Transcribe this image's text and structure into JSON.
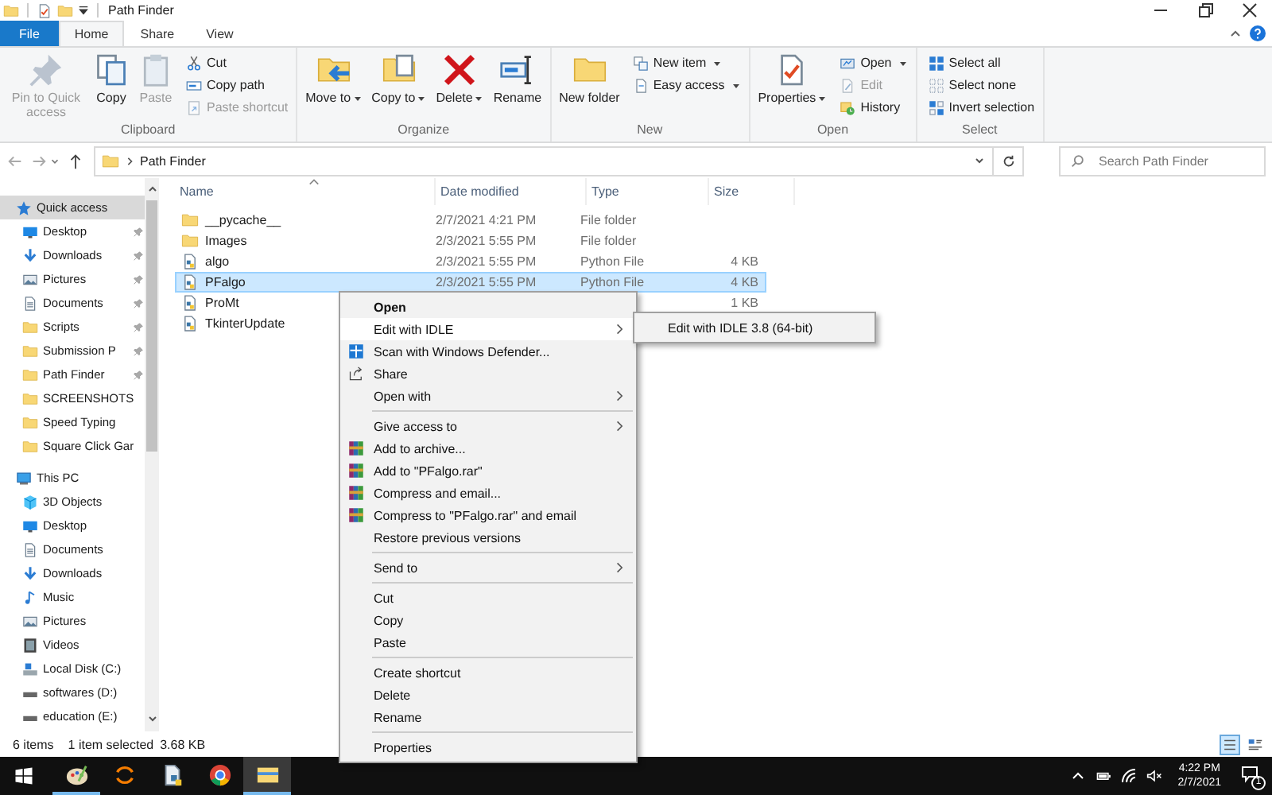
{
  "window": {
    "title": "Path Finder"
  },
  "ribbon_tabs": [
    {
      "label": "File",
      "kind": "file",
      "selected": false
    },
    {
      "label": "Home",
      "kind": "tab",
      "selected": true
    },
    {
      "label": "Share",
      "kind": "tab",
      "selected": false
    },
    {
      "label": "View",
      "kind": "tab",
      "selected": false
    }
  ],
  "ribbon_groups": [
    {
      "label": "Clipboard",
      "large": [
        {
          "label": "Pin to Quick access",
          "kind": "pin",
          "disabled": true,
          "has_menu": false
        },
        {
          "label": "Copy",
          "kind": "copy",
          "disabled": false,
          "has_menu": false
        },
        {
          "label": "Paste",
          "kind": "paste",
          "disabled": true,
          "has_menu": false
        }
      ],
      "small": [
        {
          "label": "Cut",
          "kind": "cut",
          "disabled": false,
          "has_menu": false
        },
        {
          "label": "Copy path",
          "kind": "copypath",
          "disabled": false,
          "has_menu": false
        },
        {
          "label": "Paste shortcut",
          "kind": "pasteshortcut",
          "disabled": true,
          "has_menu": false
        }
      ]
    },
    {
      "label": "Organize",
      "large": [
        {
          "label": "Move to",
          "kind": "move",
          "disabled": false,
          "has_menu": true
        },
        {
          "label": "Copy to",
          "kind": "copyto",
          "disabled": false,
          "has_menu": true
        },
        {
          "label": "Delete",
          "kind": "delete",
          "disabled": false,
          "has_menu": true
        },
        {
          "label": "Rename",
          "kind": "rename",
          "disabled": false,
          "has_menu": false
        }
      ]
    },
    {
      "label": "New",
      "large": [
        {
          "label": "New folder",
          "kind": "newfolder",
          "disabled": false,
          "has_menu": false
        }
      ],
      "small": [
        {
          "label": "New item",
          "kind": "newitem",
          "disabled": false,
          "has_menu": true
        },
        {
          "label": "Easy access",
          "kind": "easyaccess",
          "disabled": false,
          "has_menu": true
        }
      ]
    },
    {
      "label": "Open",
      "large": [
        {
          "label": "Properties",
          "kind": "properties",
          "disabled": false,
          "has_menu": true
        }
      ],
      "small": [
        {
          "label": "Open",
          "kind": "open",
          "disabled": false,
          "has_menu": true
        },
        {
          "label": "Edit",
          "kind": "edit",
          "disabled": true,
          "has_menu": false
        },
        {
          "label": "History",
          "kind": "history",
          "disabled": false,
          "has_menu": false
        }
      ]
    },
    {
      "label": "Select",
      "small": [
        {
          "label": "Select all",
          "kind": "selectall",
          "disabled": false,
          "has_menu": false
        },
        {
          "label": "Select none",
          "kind": "selectnone",
          "disabled": false,
          "has_menu": false
        },
        {
          "label": "Invert selection",
          "kind": "invert",
          "disabled": false,
          "has_menu": false
        }
      ]
    }
  ],
  "address": {
    "path": [
      "Path Finder"
    ]
  },
  "search": {
    "placeholder": "Search Path Finder"
  },
  "sidebar": [
    {
      "label": "Quick access",
      "kind": "star",
      "selected": true,
      "pinned": false,
      "children": [
        {
          "label": "Desktop",
          "kind": "desktop",
          "selected": false,
          "pinned": true
        },
        {
          "label": "Downloads",
          "kind": "downloads",
          "selected": false,
          "pinned": true
        },
        {
          "label": "Pictures",
          "kind": "pictures",
          "selected": false,
          "pinned": true
        },
        {
          "label": "Documents",
          "kind": "documents",
          "selected": false,
          "pinned": true
        },
        {
          "label": "Scripts",
          "kind": "folder",
          "selected": false,
          "pinned": true
        },
        {
          "label": "Submission P",
          "kind": "folder",
          "selected": false,
          "pinned": true
        },
        {
          "label": "Path Finder",
          "kind": "folder",
          "selected": false,
          "pinned": true
        },
        {
          "label": "SCREENSHOTS",
          "kind": "folder",
          "selected": false,
          "pinned": false
        },
        {
          "label": "Speed Typing",
          "kind": "folder",
          "selected": false,
          "pinned": false
        },
        {
          "label": "Square Click Gar",
          "kind": "folder",
          "selected": false,
          "pinned": false
        }
      ]
    },
    {
      "label": "This PC",
      "kind": "pc",
      "selected": false,
      "pinned": false,
      "children": [
        {
          "label": "3D Objects",
          "kind": "cube",
          "selected": false,
          "pinned": false
        },
        {
          "label": "Desktop",
          "kind": "desktop",
          "selected": false,
          "pinned": false
        },
        {
          "label": "Documents",
          "kind": "documents",
          "selected": false,
          "pinned": false
        },
        {
          "label": "Downloads",
          "kind": "downloads",
          "selected": false,
          "pinned": false
        },
        {
          "label": "Music",
          "kind": "music",
          "selected": false,
          "pinned": false
        },
        {
          "label": "Pictures",
          "kind": "pictures",
          "selected": false,
          "pinned": false
        },
        {
          "label": "Videos",
          "kind": "videos",
          "selected": false,
          "pinned": false
        },
        {
          "label": "Local Disk (C:)",
          "kind": "systemdisk",
          "selected": false,
          "pinned": false
        },
        {
          "label": "softwares (D:)",
          "kind": "drive",
          "selected": false,
          "pinned": false
        },
        {
          "label": "education (E:)",
          "kind": "drive",
          "selected": false,
          "pinned": false
        }
      ]
    }
  ],
  "table": {
    "columns": [
      {
        "label": "Name",
        "sorted": true
      },
      {
        "label": "Date modified",
        "sorted": false
      },
      {
        "label": "Type",
        "sorted": false
      },
      {
        "label": "Size",
        "sorted": false
      }
    ],
    "rows": [
      {
        "name": "__pycache__",
        "kind": "folder",
        "date": "2/7/2021 4:21 PM",
        "type": "File folder",
        "selected": false
      },
      {
        "name": "Images",
        "kind": "folder",
        "date": "2/3/2021 5:55 PM",
        "type": "File folder",
        "selected": false
      },
      {
        "name": "algo",
        "kind": "python",
        "date": "2/3/2021 5:55 PM",
        "type": "Python File",
        "size": "4 KB",
        "selected": false
      },
      {
        "name": "PFalgo",
        "kind": "python",
        "date": "2/3/2021 5:55 PM",
        "type": "Python File",
        "size": "4 KB",
        "selected": true
      },
      {
        "name": "ProMt",
        "kind": "python",
        "size": "1 KB",
        "selected": false
      },
      {
        "name": "TkinterUpdate",
        "kind": "python",
        "selected": false
      }
    ]
  },
  "status_bar": {
    "item_count": "6 items",
    "selection": "1 item selected",
    "selection_size": "3.68 KB",
    "views": [
      {
        "kind": "details",
        "selected": true
      },
      {
        "kind": "tiles",
        "selected": false
      }
    ]
  },
  "context_menu": {
    "sections": [
      [
        {
          "label": "Open",
          "kind": "plain",
          "bold": true,
          "submenu": false,
          "selected": false
        },
        {
          "label": "Edit with IDLE",
          "kind": "plain",
          "bold": false,
          "submenu": true,
          "selected": true
        },
        {
          "label": "Scan with Windows Defender...",
          "kind": "defender",
          "bold": false,
          "submenu": false,
          "selected": false
        },
        {
          "label": "Share",
          "kind": "share",
          "bold": false,
          "submenu": false,
          "selected": false
        },
        {
          "label": "Open with",
          "kind": "plain",
          "bold": false,
          "submenu": true,
          "selected": false
        }
      ],
      [
        {
          "label": "Give access to",
          "kind": "plain",
          "bold": false,
          "submenu": true,
          "selected": false
        },
        {
          "label": "Add to archive...",
          "kind": "winrar",
          "bold": false,
          "submenu": false,
          "selected": false
        },
        {
          "label": "Add to \"PFalgo.rar\"",
          "kind": "winrar",
          "bold": false,
          "submenu": false,
          "selected": false
        },
        {
          "label": "Compress and email...",
          "kind": "winrar",
          "bold": false,
          "submenu": false,
          "selected": false
        },
        {
          "label": "Compress to \"PFalgo.rar\" and email",
          "kind": "winrar",
          "bold": false,
          "submenu": false,
          "selected": false
        },
        {
          "label": "Restore previous versions",
          "kind": "plain",
          "bold": false,
          "submenu": false,
          "selected": false
        }
      ],
      [
        {
          "label": "Send to",
          "kind": "plain",
          "bold": false,
          "submenu": true,
          "selected": false
        }
      ],
      [
        {
          "label": "Cut",
          "kind": "plain",
          "bold": false,
          "submenu": false,
          "selected": false
        },
        {
          "label": "Copy",
          "kind": "plain",
          "bold": false,
          "submenu": false,
          "selected": false
        },
        {
          "label": "Paste",
          "kind": "plain",
          "bold": false,
          "submenu": false,
          "selected": false
        }
      ],
      [
        {
          "label": "Create shortcut",
          "kind": "plain",
          "bold": false,
          "submenu": false,
          "selected": false
        },
        {
          "label": "Delete",
          "kind": "plain",
          "bold": false,
          "submenu": false,
          "selected": false
        },
        {
          "label": "Rename",
          "kind": "plain",
          "bold": false,
          "submenu": false,
          "selected": false
        }
      ],
      [
        {
          "label": "Properties",
          "kind": "plain",
          "bold": false,
          "submenu": false,
          "selected": false
        }
      ]
    ],
    "submenu": [
      {
        "label": "Edit with IDLE 3.8 (64-bit)"
      }
    ]
  },
  "taskbar": {
    "apps": [
      {
        "kind": "paint",
        "running": true,
        "selected": false
      },
      {
        "kind": "loop",
        "running": false,
        "selected": false
      },
      {
        "kind": "installer",
        "running": false,
        "selected": false
      },
      {
        "kind": "chrome",
        "running": false,
        "selected": false
      },
      {
        "kind": "explorer",
        "running": true,
        "selected": true
      }
    ],
    "time": "4:22 PM",
    "date": "2/7/2021",
    "notifications": "1"
  }
}
